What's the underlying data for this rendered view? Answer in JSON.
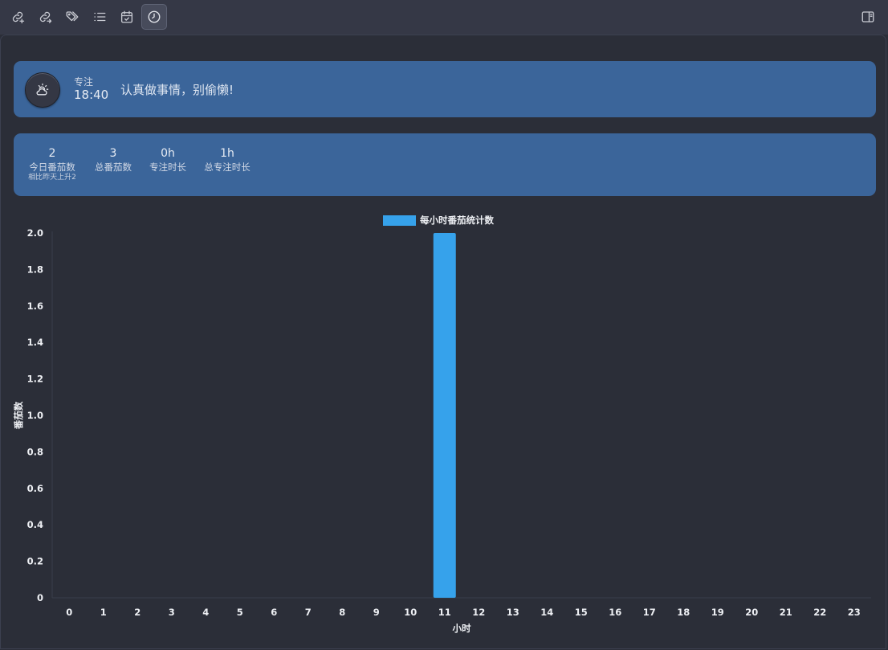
{
  "toolbar": {
    "left_icons": [
      {
        "name": "link-add-icon"
      },
      {
        "name": "link-out-icon"
      },
      {
        "name": "tags-icon"
      },
      {
        "name": "list-icon"
      },
      {
        "name": "calendar-check-icon"
      },
      {
        "name": "clock-icon",
        "active": true
      }
    ],
    "right_icons": [
      {
        "name": "sidebar-toggle-icon"
      }
    ]
  },
  "focus": {
    "label": "专注",
    "time": "18:40",
    "message": "认真做事情，别偷懒!"
  },
  "stats": [
    {
      "value": "2",
      "label": "今日番茄数",
      "note": "相比昨天上升2"
    },
    {
      "value": "3",
      "label": "总番茄数",
      "note": ""
    },
    {
      "value": "0h",
      "label": "专注时长",
      "note": ""
    },
    {
      "value": "1h",
      "label": "总专注时长",
      "note": ""
    }
  ],
  "colors": {
    "accent_bar": "#36a2eb",
    "card": "#3b659a",
    "background": "#2b2e38"
  },
  "chart_data": {
    "type": "bar",
    "categories": [
      "0",
      "1",
      "2",
      "3",
      "4",
      "5",
      "6",
      "7",
      "8",
      "9",
      "10",
      "11",
      "12",
      "13",
      "14",
      "15",
      "16",
      "17",
      "18",
      "19",
      "20",
      "21",
      "22",
      "23"
    ],
    "series": [
      {
        "name": "每小时番茄统计数",
        "values": [
          0,
          0,
          0,
          0,
          0,
          0,
          0,
          0,
          0,
          0,
          0,
          2,
          0,
          0,
          0,
          0,
          0,
          0,
          0,
          0,
          0,
          0,
          0,
          0
        ]
      }
    ],
    "xlabel": "小时",
    "ylabel": "番茄数",
    "ylim": [
      0,
      2
    ],
    "yticks": [
      "0",
      "0.2",
      "0.4",
      "0.6",
      "0.8",
      "1.0",
      "1.2",
      "1.4",
      "1.6",
      "1.8",
      "2.0"
    ],
    "legend": "top-center",
    "grid": false
  }
}
